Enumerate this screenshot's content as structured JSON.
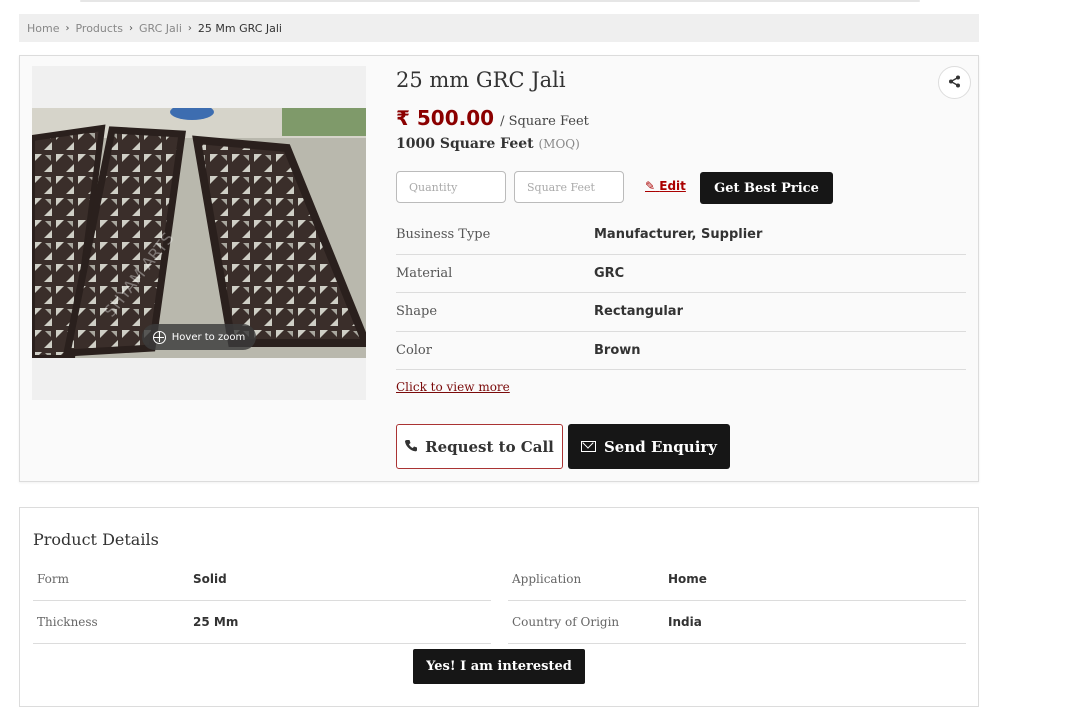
{
  "breadcrumb": {
    "items": [
      "Home",
      "Products",
      "GRC Jali"
    ],
    "current": "25 Mm GRC Jali"
  },
  "product": {
    "title": "25 mm GRC Jali",
    "price": "₹ 500.00",
    "price_unit": "/ Square Feet",
    "moq_value": "1000 Square Feet",
    "moq_label": "(MOQ)",
    "zoom_hint": "Hover to zoom",
    "image_colors": {
      "panel": "#3a2e2a",
      "ground": "#b9b8ad"
    }
  },
  "order": {
    "quantity_placeholder": "Quantity",
    "unit_placeholder": "Square Feet",
    "edit_label": "Edit",
    "best_price_label": "Get Best Price"
  },
  "specs": [
    {
      "label": "Business Type",
      "value": "Manufacturer, Supplier"
    },
    {
      "label": "Material",
      "value": "GRC"
    },
    {
      "label": "Shape",
      "value": "Rectangular"
    },
    {
      "label": "Color",
      "value": "Brown"
    }
  ],
  "view_more": "Click to view more",
  "actions": {
    "call_label": "Request to Call",
    "enquiry_label": "Send Enquiry"
  },
  "details": {
    "heading": "Product Details",
    "left": [
      {
        "label": "Form",
        "value": "Solid"
      },
      {
        "label": "Thickness",
        "value": "25 Mm"
      }
    ],
    "right": [
      {
        "label": "Application",
        "value": "Home"
      },
      {
        "label": "Country of Origin",
        "value": "India"
      }
    ],
    "interested_label": "Yes! I am interested"
  },
  "colors": {
    "accent": "#8b0000",
    "dark_button": "#161616"
  }
}
